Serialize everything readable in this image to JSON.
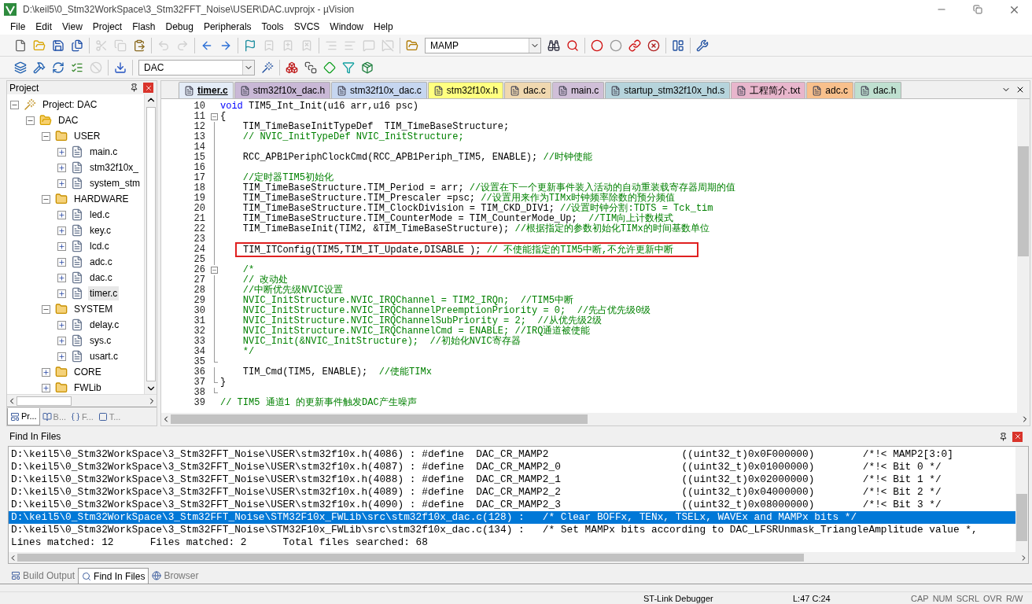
{
  "window": {
    "title": "D:\\keil5\\0_Stm32WorkSpace\\3_Stm32FFT_Noise\\USER\\DAC.uvprojx - µVision"
  },
  "menu": [
    "File",
    "Edit",
    "View",
    "Project",
    "Flash",
    "Debug",
    "Peripherals",
    "Tools",
    "SVCS",
    "Window",
    "Help"
  ],
  "toolbar_1": [
    {
      "kind": "new",
      "disabled": false
    },
    {
      "kind": "open",
      "disabled": false
    },
    {
      "kind": "save",
      "disabled": false
    },
    {
      "kind": "save-all",
      "disabled": false
    },
    {
      "kind": "separator"
    },
    {
      "kind": "cut",
      "disabled": true
    },
    {
      "kind": "copy",
      "disabled": true
    },
    {
      "kind": "paste",
      "disabled": false
    },
    {
      "kind": "separator"
    },
    {
      "kind": "undo",
      "disabled": true
    },
    {
      "kind": "redo",
      "disabled": true
    },
    {
      "kind": "separator"
    },
    {
      "kind": "back",
      "disabled": false
    },
    {
      "kind": "forward",
      "disabled": false
    },
    {
      "kind": "separator"
    },
    {
      "kind": "bookmark",
      "disabled": false
    },
    {
      "kind": "bookmark-prev",
      "disabled": true
    },
    {
      "kind": "bookmark-next",
      "disabled": true
    },
    {
      "kind": "bookmark-clear",
      "disabled": true
    },
    {
      "kind": "separator"
    },
    {
      "kind": "indent",
      "disabled": true
    },
    {
      "kind": "unindent",
      "disabled": true
    },
    {
      "kind": "comment",
      "disabled": true
    },
    {
      "kind": "uncomment",
      "disabled": true
    },
    {
      "kind": "separator"
    },
    {
      "kind": "find-in-files",
      "disabled": false
    }
  ],
  "find_combo": {
    "value": "MAMP"
  },
  "toolbar_1_right": [
    {
      "kind": "find",
      "disabled": false
    },
    {
      "kind": "debug-search",
      "disabled": false
    },
    {
      "kind": "separator"
    },
    {
      "kind": "breakpoint",
      "disabled": false
    },
    {
      "kind": "breakpoint-off",
      "disabled": false
    },
    {
      "kind": "breakpoint-disable-all",
      "disabled": false
    },
    {
      "kind": "breakpoint-kill-all",
      "disabled": false
    },
    {
      "kind": "separator"
    },
    {
      "kind": "window-layout",
      "disabled": false
    },
    {
      "kind": "separator"
    },
    {
      "kind": "settings",
      "disabled": false
    }
  ],
  "toolbar_2": [
    {
      "kind": "translate",
      "disabled": false
    },
    {
      "kind": "build",
      "disabled": false
    },
    {
      "kind": "rebuild",
      "disabled": false
    },
    {
      "kind": "batch-build",
      "disabled": false
    },
    {
      "kind": "stop-build",
      "disabled": true
    },
    {
      "kind": "separator"
    },
    {
      "kind": "download",
      "disabled": false
    },
    {
      "kind": "separator"
    }
  ],
  "target_combo": {
    "value": "DAC"
  },
  "toolbar_2_right": [
    {
      "kind": "target-options",
      "disabled": false
    },
    {
      "kind": "separator"
    },
    {
      "kind": "manage-components",
      "disabled": false
    },
    {
      "kind": "multi-project",
      "disabled": false
    },
    {
      "kind": "green-diamond",
      "disabled": false
    },
    {
      "kind": "funnel",
      "disabled": false
    },
    {
      "kind": "pack",
      "disabled": false
    }
  ],
  "project_panel": {
    "title": "Project",
    "tree": [
      {
        "label": "Project: DAC",
        "kind": "project",
        "expanded": true,
        "selected": false,
        "children": [
          {
            "label": "DAC",
            "kind": "target",
            "expanded": true,
            "selected": false,
            "children": [
              {
                "label": "USER",
                "kind": "folder",
                "expanded": true,
                "selected": false,
                "children": [
                  {
                    "label": "main.c",
                    "kind": "file",
                    "expanded": false,
                    "selected": false
                  },
                  {
                    "label": "stm32f10x_",
                    "kind": "file",
                    "expanded": false,
                    "selected": false
                  },
                  {
                    "label": "system_stm",
                    "kind": "file",
                    "expanded": false,
                    "selected": false
                  }
                ]
              },
              {
                "label": "HARDWARE",
                "kind": "folder",
                "expanded": true,
                "selected": false,
                "children": [
                  {
                    "label": "led.c",
                    "kind": "file",
                    "expanded": false,
                    "selected": false
                  },
                  {
                    "label": "key.c",
                    "kind": "file",
                    "expanded": false,
                    "selected": false
                  },
                  {
                    "label": "lcd.c",
                    "kind": "file",
                    "expanded": false,
                    "selected": false
                  },
                  {
                    "label": "adc.c",
                    "kind": "file",
                    "expanded": false,
                    "selected": false
                  },
                  {
                    "label": "dac.c",
                    "kind": "file",
                    "expanded": false,
                    "selected": false
                  },
                  {
                    "label": "timer.c",
                    "kind": "file",
                    "expanded": false,
                    "selected": true
                  }
                ]
              },
              {
                "label": "SYSTEM",
                "kind": "folder",
                "expanded": true,
                "selected": false,
                "children": [
                  {
                    "label": "delay.c",
                    "kind": "file",
                    "expanded": false,
                    "selected": false
                  },
                  {
                    "label": "sys.c",
                    "kind": "file",
                    "expanded": false,
                    "selected": false
                  },
                  {
                    "label": "usart.c",
                    "kind": "file",
                    "expanded": false,
                    "selected": false
                  }
                ]
              },
              {
                "label": "CORE",
                "kind": "folder",
                "expanded": false,
                "selected": false
              },
              {
                "label": "FWLib",
                "kind": "folder",
                "expanded": false,
                "selected": false
              }
            ]
          }
        ]
      }
    ],
    "tabs": [
      {
        "label": "Pr...",
        "kind": "project",
        "selected": true
      },
      {
        "label": "B...",
        "kind": "books",
        "selected": false
      },
      {
        "label": "F...",
        "kind": "braces",
        "selected": false
      },
      {
        "label": "T...",
        "kind": "template",
        "selected": false
      }
    ]
  },
  "editor_tabs": [
    {
      "label": "timer.c",
      "color": "#e4ecf7",
      "selected": true
    },
    {
      "label": "stm32f10x_dac.h",
      "color": "#c9b8d6",
      "selected": false
    },
    {
      "label": "stm32f10x_dac.c",
      "color": "#c6d6f0",
      "selected": false
    },
    {
      "label": "stm32f10x.h",
      "color": "#ffff80",
      "selected": false
    },
    {
      "label": "dac.c",
      "color": "#f0d8b0",
      "selected": false
    },
    {
      "label": "main.c",
      "color": "#d0bfd8",
      "selected": false
    },
    {
      "label": "startup_stm32f10x_hd.s",
      "color": "#b6d4dc",
      "selected": false
    },
    {
      "label": "工程简介.txt",
      "color": "#e8b6cc",
      "selected": false
    },
    {
      "label": "adc.c",
      "color": "#f8c08c",
      "selected": false
    },
    {
      "label": "dac.h",
      "color": "#bfe0d0",
      "selected": false
    }
  ],
  "code_lines": [
    {
      "number": "10",
      "kind": "plain",
      "boxed": false,
      "segments": [
        {
          "kind": "keyword",
          "text": "void"
        },
        {
          "kind": "code",
          "text": " TIM5_Int_Init(u16 arr,u16 psc)"
        }
      ]
    },
    {
      "number": "11",
      "kind": "fold-start",
      "boxed": false,
      "segments": [
        {
          "kind": "code",
          "text": "{"
        }
      ]
    },
    {
      "number": "12",
      "kind": "fold-body",
      "boxed": false,
      "segments": [
        {
          "kind": "code",
          "text": "    TIM_TimeBaseInitTypeDef  TIM_TimeBaseStructure;"
        }
      ]
    },
    {
      "number": "13",
      "kind": "fold-body",
      "boxed": false,
      "segments": [
        {
          "kind": "comment",
          "text": "    // NVIC_InitTypeDef NVIC_InitStructure;"
        }
      ]
    },
    {
      "number": "14",
      "kind": "fold-body",
      "boxed": false
    },
    {
      "number": "15",
      "kind": "fold-body",
      "boxed": false,
      "segments": [
        {
          "kind": "code",
          "text": "    RCC_APB1PeriphClockCmd(RCC_APB1Periph_TIM5, ENABLE); "
        },
        {
          "kind": "comment",
          "text": "//时钟使能"
        }
      ]
    },
    {
      "number": "16",
      "kind": "fold-body",
      "boxed": false
    },
    {
      "number": "17",
      "kind": "fold-body",
      "boxed": false,
      "segments": [
        {
          "kind": "comment",
          "text": "    //定时器TIM5初始化"
        }
      ]
    },
    {
      "number": "18",
      "kind": "fold-body",
      "boxed": false,
      "segments": [
        {
          "kind": "code",
          "text": "    TIM_TimeBaseStructure.TIM_Period = arr; "
        },
        {
          "kind": "comment",
          "text": "//设置在下一个更新事件装入活动的自动重装载寄存器周期的值"
        }
      ]
    },
    {
      "number": "19",
      "kind": "fold-body",
      "boxed": false,
      "segments": [
        {
          "kind": "code",
          "text": "    TIM_TimeBaseStructure.TIM_Prescaler =psc; "
        },
        {
          "kind": "comment",
          "text": "//设置用来作为TIMx时钟频率除数的预分频值"
        }
      ]
    },
    {
      "number": "20",
      "kind": "fold-body",
      "boxed": false,
      "segments": [
        {
          "kind": "code",
          "text": "    TIM_TimeBaseStructure.TIM_ClockDivision = TIM_CKD_DIV1; "
        },
        {
          "kind": "comment",
          "text": "//设置时钟分割:TDTS = Tck_tim"
        }
      ]
    },
    {
      "number": "21",
      "kind": "fold-body",
      "boxed": false,
      "segments": [
        {
          "kind": "code",
          "text": "    TIM_TimeBaseStructure.TIM_CounterMode = TIM_CounterMode_Up;  "
        },
        {
          "kind": "comment",
          "text": "//TIM向上计数模式"
        }
      ]
    },
    {
      "number": "22",
      "kind": "fold-body",
      "boxed": false,
      "segments": [
        {
          "kind": "code",
          "text": "    TIM_TimeBaseInit(TIM2, &TIM_TimeBaseStructure); "
        },
        {
          "kind": "comment",
          "text": "//根据指定的参数初始化TIMx的时间基数单位"
        }
      ]
    },
    {
      "number": "23",
      "kind": "fold-body",
      "boxed": false
    },
    {
      "number": "24",
      "kind": "fold-body",
      "boxed": true,
      "segments": [
        {
          "kind": "code",
          "text": "TIM_ITConfig(TIM5,TIM_IT_Update,DISABLE ); "
        },
        {
          "kind": "comment",
          "text": "// 不使能指定的TIM5中断,不允许更新中断"
        }
      ]
    },
    {
      "number": "25",
      "kind": "fold-body",
      "boxed": false
    },
    {
      "number": "26",
      "kind": "fold-start",
      "boxed": false,
      "segments": [
        {
          "kind": "comment",
          "text": "    /*"
        }
      ]
    },
    {
      "number": "27",
      "kind": "fold-body",
      "boxed": false,
      "segments": [
        {
          "kind": "comment",
          "text": "    // 改动处"
        }
      ]
    },
    {
      "number": "28",
      "kind": "fold-body",
      "boxed": false,
      "segments": [
        {
          "kind": "comment",
          "text": "    //中断优先级NVIC设置"
        }
      ]
    },
    {
      "number": "29",
      "kind": "fold-body",
      "boxed": false,
      "segments": [
        {
          "kind": "comment",
          "text": "    NVIC_InitStructure.NVIC_IRQChannel = TIM2_IRQn;  //TIM5中断"
        }
      ]
    },
    {
      "number": "30",
      "kind": "fold-body",
      "boxed": false,
      "segments": [
        {
          "kind": "comment",
          "text": "    NVIC_InitStructure.NVIC_IRQChannelPreemptionPriority = 0;  //先占优先级0级"
        }
      ]
    },
    {
      "number": "31",
      "kind": "fold-body",
      "boxed": false,
      "segments": [
        {
          "kind": "comment",
          "text": "    NVIC_InitStructure.NVIC_IRQChannelSubPriority = 2;  //从优先级2级"
        }
      ]
    },
    {
      "number": "32",
      "kind": "fold-body",
      "boxed": false,
      "segments": [
        {
          "kind": "comment",
          "text": "    NVIC_InitStructure.NVIC_IRQChannelCmd = ENABLE; //IRQ通道被使能"
        }
      ]
    },
    {
      "number": "33",
      "kind": "fold-body",
      "boxed": false,
      "segments": [
        {
          "kind": "comment",
          "text": "    NVIC_Init(&NVIC_InitStructure);  //初始化NVIC寄存器"
        }
      ]
    },
    {
      "number": "34",
      "kind": "fold-body",
      "boxed": false,
      "segments": [
        {
          "kind": "comment",
          "text": "    */"
        }
      ]
    },
    {
      "number": "35",
      "kind": "fold-end",
      "boxed": false
    },
    {
      "number": "36",
      "kind": "fold-body",
      "boxed": false,
      "segments": [
        {
          "kind": "code",
          "text": "    TIM_Cmd(TIM5, ENABLE);  "
        },
        {
          "kind": "comment",
          "text": "//使能TIMx"
        }
      ]
    },
    {
      "number": "37",
      "kind": "fold-end",
      "boxed": false,
      "segments": [
        {
          "kind": "code",
          "text": "}"
        }
      ]
    },
    {
      "number": "38",
      "kind": "fold-end",
      "boxed": false
    },
    {
      "number": "39",
      "kind": "plain",
      "boxed": false,
      "segments": [
        {
          "kind": "comment",
          "text": "// TIM5 通道1 的更新事件触发DAC产生噪声"
        }
      ]
    }
  ],
  "find_panel": {
    "title": "Find In Files",
    "results": [
      {
        "text": "D:\\keil5\\0_Stm32WorkSpace\\3_Stm32FFT_Noise\\USER\\stm32f10x.h(4086) : #define  DAC_CR_MAMP2                      ((uint32_t)0x0F000000)        /*!< MAMP2[3:0]",
        "selected": false
      },
      {
        "text": "D:\\keil5\\0_Stm32WorkSpace\\3_Stm32FFT_Noise\\USER\\stm32f10x.h(4087) : #define  DAC_CR_MAMP2_0                    ((uint32_t)0x01000000)        /*!< Bit 0 */",
        "selected": false
      },
      {
        "text": "D:\\keil5\\0_Stm32WorkSpace\\3_Stm32FFT_Noise\\USER\\stm32f10x.h(4088) : #define  DAC_CR_MAMP2_1                    ((uint32_t)0x02000000)        /*!< Bit 1 */",
        "selected": false
      },
      {
        "text": "D:\\keil5\\0_Stm32WorkSpace\\3_Stm32FFT_Noise\\USER\\stm32f10x.h(4089) : #define  DAC_CR_MAMP2_2                    ((uint32_t)0x04000000)        /*!< Bit 2 */",
        "selected": false
      },
      {
        "text": "D:\\keil5\\0_Stm32WorkSpace\\3_Stm32FFT_Noise\\USER\\stm32f10x.h(4090) : #define  DAC_CR_MAMP2_3                    ((uint32_t)0x08000000)        /*!< Bit 3 */",
        "selected": false
      },
      {
        "text": "D:\\keil5\\0_Stm32WorkSpace\\3_Stm32FFT_Noise\\STM32F10x_FWLib\\src\\stm32f10x_dac.c(128) :   /* Clear BOFFx, TENx, TSELx, WAVEx and MAMPx bits */",
        "selected": true
      },
      {
        "text": "D:\\keil5\\0_Stm32WorkSpace\\3_Stm32FFT_Noise\\STM32F10x_FWLib\\src\\stm32f10x_dac.c(134) :   /* Set MAMPx bits according to DAC_LFSRUnmask_TriangleAmplitude value *,",
        "selected": false
      },
      {
        "text": "Lines matched: 12      Files matched: 2      Total files searched: 68",
        "selected": false
      }
    ]
  },
  "output_tabs": [
    {
      "label": "Build Output",
      "kind": "build",
      "selected": false
    },
    {
      "label": "Find In Files",
      "kind": "find",
      "selected": true
    },
    {
      "label": "Browser",
      "kind": "browser",
      "selected": false
    }
  ],
  "status_bar": {
    "debugger": "ST-Link Debugger",
    "position": "L:47 C:24",
    "indicators": [
      "CAP",
      "NUM",
      "SCRL",
      "OVR",
      "R/W"
    ]
  }
}
